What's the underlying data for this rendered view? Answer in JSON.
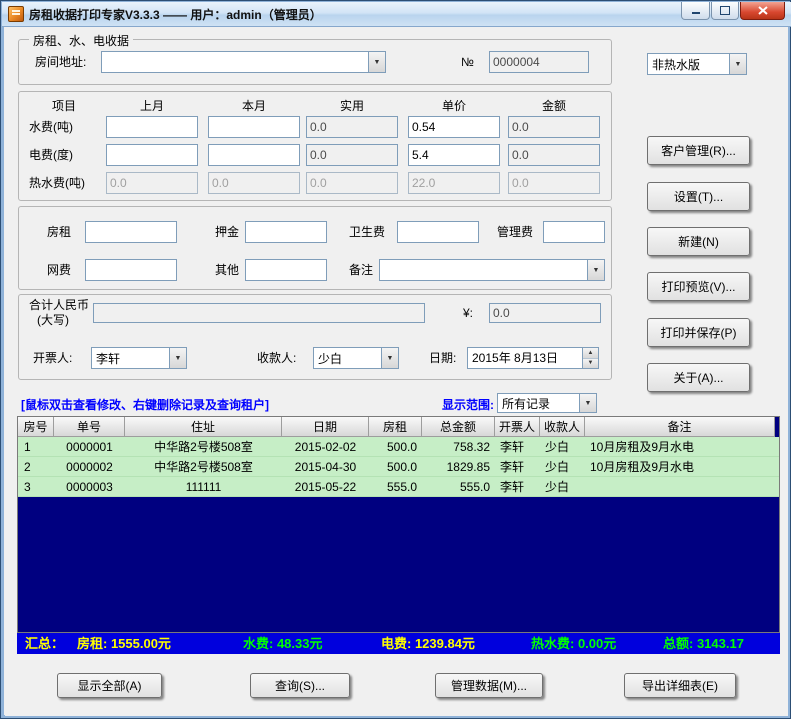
{
  "window": {
    "title": "房租收据打印专家V3.3.3 —— 用户：admin（管理员）"
  },
  "icons": {
    "chevron_down": "▼",
    "spin_up": "▲",
    "spin_down": "▼"
  },
  "receipt": {
    "group_title": "房租、水、电收据",
    "address_label": "房间地址:",
    "address_value": "",
    "number_label": "№",
    "number_value": "0000004",
    "version_value": "非热水版",
    "grid": {
      "col_item": "项目",
      "col_last": "上月",
      "col_current": "本月",
      "col_usage": "实用",
      "col_price": "单价",
      "col_amount": "金额",
      "rows": [
        {
          "label": "水费(吨)",
          "last": "",
          "current": "",
          "usage": "0.0",
          "price": "0.54",
          "amount": "0.0"
        },
        {
          "label": "电费(度)",
          "last": "",
          "current": "",
          "usage": "0.0",
          "price": "5.4",
          "amount": "0.0"
        },
        {
          "label": "热水费(吨)",
          "last": "0.0",
          "current": "0.0",
          "usage": "0.0",
          "price": "22.0",
          "amount": "0.0"
        }
      ]
    },
    "rent_label": "房租",
    "rent_value": "",
    "deposit_label": "押金",
    "deposit_value": "",
    "sanitation_label": "卫生费",
    "sanitation_value": "",
    "management_label": "管理费",
    "management_value": "",
    "internet_label": "网费",
    "internet_value": "",
    "other_label": "其他",
    "other_value": "",
    "remark_label": "备注",
    "remark_value": "",
    "total_label_line1": "合计人民币",
    "total_label_line2": "(大写)",
    "total_in_words_value": "",
    "yuan_label": "¥:",
    "yuan_value": "0.0",
    "issuer_label": "开票人:",
    "issuer_value": "李轩",
    "payee_label": "收款人:",
    "payee_value": "少白",
    "date_label": "日期:",
    "date_value": "2015年 8月13日"
  },
  "side_buttons": {
    "customers": "客户管理(R)...",
    "settings": "设置(T)...",
    "new": "新建(N)",
    "print_preview": "打印预览(V)...",
    "print_save": "打印并保存(P)",
    "about": "关于(A)..."
  },
  "records": {
    "hint": "[鼠标双击查看修改、右键删除记录及查询租户]",
    "range_label": "显示范围:",
    "range_value": "所有记录",
    "headers": [
      "房号",
      "单号",
      "住址",
      "日期",
      "房租",
      "总金额",
      "开票人",
      "收款人",
      "备注"
    ],
    "rows": [
      [
        "1",
        "0000001",
        "中华路2号楼508室",
        "2015-02-02",
        "500.0",
        "758.32",
        "李轩",
        "少白",
        "10月房租及9月水电"
      ],
      [
        "2",
        "0000002",
        "中华路2号楼508室",
        "2015-04-30",
        "500.0",
        "1829.85",
        "李轩",
        "少白",
        "10月房租及9月水电"
      ],
      [
        "3",
        "0000003",
        "111111",
        "2015-05-22",
        "555.0",
        "555.0",
        "李轩",
        "少白",
        ""
      ]
    ]
  },
  "summary": {
    "segments": [
      {
        "text": "汇总：",
        "color": "#ffff00"
      },
      {
        "text": "房租: 1555.00元",
        "color": "#ffff00"
      },
      {
        "text": "水费: 48.33元",
        "color": "#00ff00"
      },
      {
        "text": "电费: 1239.84元",
        "color": "#ffff00"
      },
      {
        "text": "热水费: 0.00元",
        "color": "#00ff00"
      },
      {
        "text": "总额: 3143.17",
        "color": "#00ff00"
      }
    ]
  },
  "bottom_buttons": {
    "show_all": "显示全部(A)",
    "query": "查询(S)...",
    "manage": "管理数据(M)...",
    "export": "导出详细表(E)"
  },
  "colors": {
    "row_green": "#c6eec6",
    "table_navy": "#000080",
    "summary_blue": "#0000dd",
    "hint_blue": "#0000ff"
  }
}
